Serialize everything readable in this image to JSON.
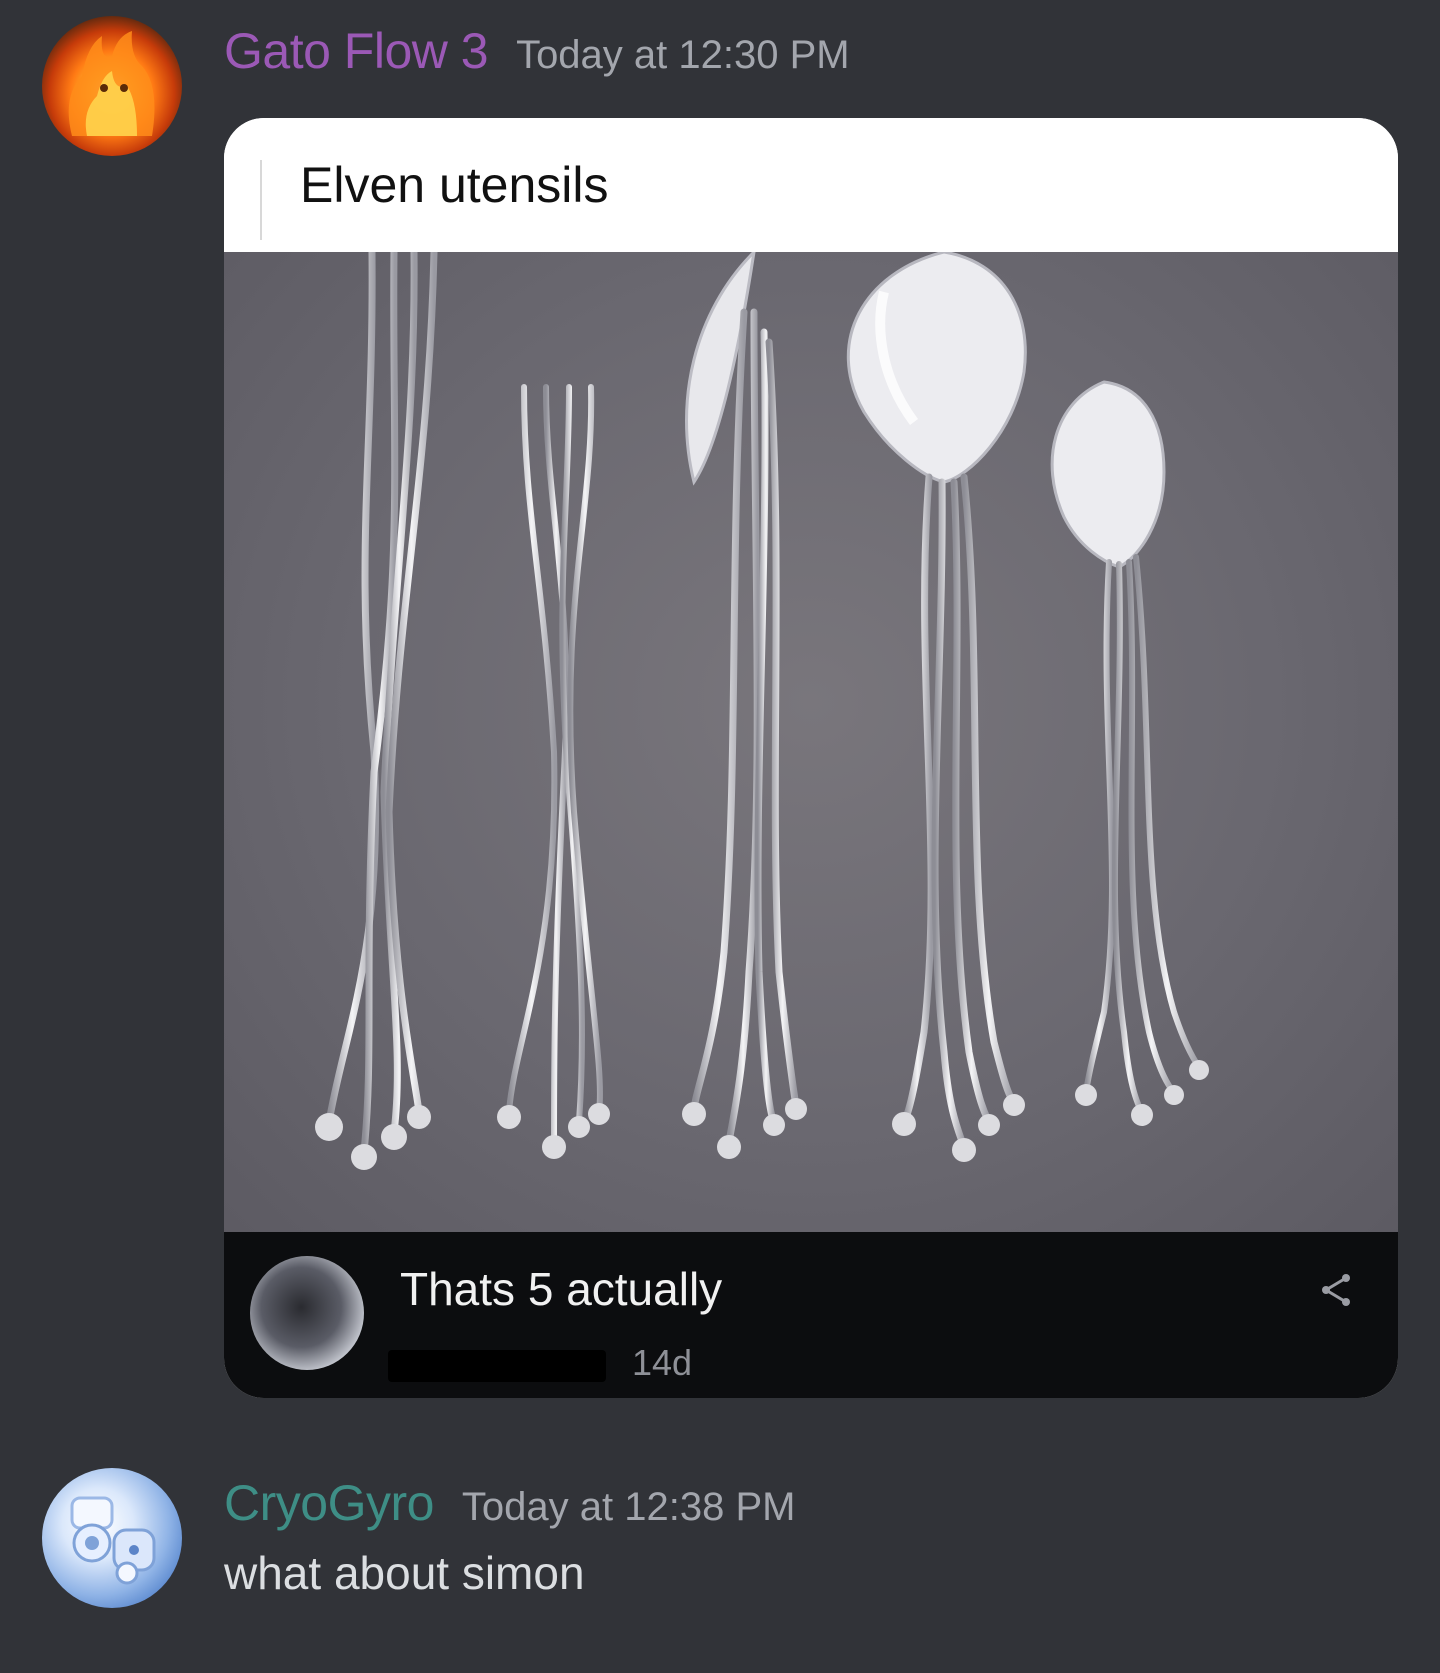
{
  "messages": [
    {
      "username": "Gato Flow 3",
      "username_color": "#9b59b6",
      "timestamp": "Today at 12:30 PM",
      "avatar_icon": "fire-cat-avatar",
      "attachment": {
        "title": "Elven utensils",
        "comment": {
          "text": "Thats 5 actually",
          "age": "14d",
          "share_icon": "share-icon"
        }
      }
    },
    {
      "username": "CryoGyro",
      "username_color": "#3e8e86",
      "timestamp": "Today at 12:38 PM",
      "avatar_icon": "robot-avatar",
      "text": "what about simon"
    }
  ],
  "colors": {
    "background": "#313338",
    "timestamp": "#a3a6ad",
    "message_text": "#dbdee1"
  }
}
